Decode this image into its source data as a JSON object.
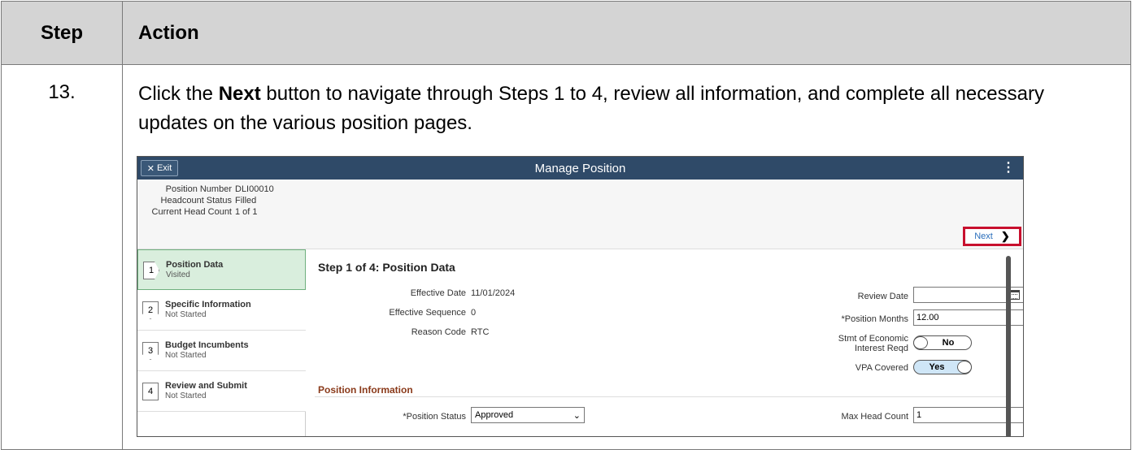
{
  "table": {
    "header_step": "Step",
    "header_action": "Action",
    "step_number": "13.",
    "instruction_pre": "Click the ",
    "instruction_bold": "Next",
    "instruction_post": " button to navigate through Steps 1 to 4, review all information, and complete all necessary updates on the various position pages."
  },
  "screenshot": {
    "exit_label": "Exit",
    "title": "Manage Position",
    "summary": [
      {
        "label": "Position Number",
        "value": "DLI00010"
      },
      {
        "label": "Headcount Status",
        "value": "Filled"
      },
      {
        "label": "Current Head Count",
        "value": "1 of 1"
      }
    ],
    "next_label": "Next",
    "steps": [
      {
        "num": "1",
        "name": "Position Data",
        "state": "Visited"
      },
      {
        "num": "2",
        "name": "Specific Information",
        "state": "Not Started"
      },
      {
        "num": "3",
        "name": "Budget Incumbents",
        "state": "Not Started"
      },
      {
        "num": "4",
        "name": "Review and Submit",
        "state": "Not Started"
      }
    ],
    "content_title": "Step 1 of 4: Position Data",
    "left_fields": [
      {
        "label": "Effective Date",
        "value": "11/01/2024"
      },
      {
        "label": "Effective Sequence",
        "value": "0"
      },
      {
        "label": "Reason Code",
        "value": "RTC"
      }
    ],
    "review_date_label": "Review Date",
    "review_date_value": "",
    "position_months_label": "*Position Months",
    "position_months_value": "12.00",
    "stmt_label_line1": "Stmt of Economic",
    "stmt_label_line2": "Interest Reqd",
    "stmt_value": "No",
    "vpa_label": "VPA Covered",
    "vpa_value": "Yes",
    "section_title": "Position Information",
    "position_status_label": "*Position Status",
    "position_status_value": "Approved",
    "max_head_count_label": "Max Head Count",
    "max_head_count_value": "1"
  },
  "colors": {
    "header_bg": "#d4d4d4",
    "banner": "#2f4a68",
    "highlight": "#c8102e",
    "active_step": "#d9eedd"
  }
}
